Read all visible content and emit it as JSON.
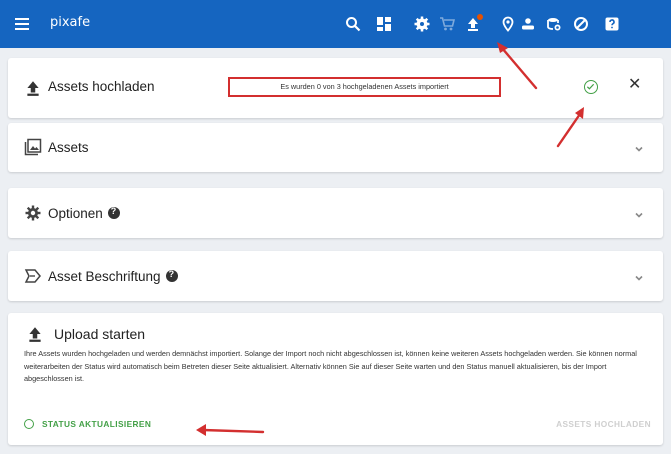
{
  "app": {
    "title": "pixafe"
  },
  "topbar": {
    "icons": [
      "search-icon",
      "dashboard-icon",
      "settings-icon",
      "cart-icon",
      "upload-icon",
      "location-icon",
      "users-icon",
      "stack-icon",
      "help-circle-icon",
      "help-square-icon"
    ]
  },
  "upload_panel": {
    "title": "Assets hochladen",
    "notice": "Es wurden 0 von 3 hochgeladenen Assets importiert"
  },
  "panels": {
    "assets": "Assets",
    "options": "Optionen",
    "labeling": "Asset Beschriftung"
  },
  "start": {
    "title": "Upload starten",
    "description": "Ihre Assets wurden hochgeladen und werden demnächst importiert. Solange der Import noch nicht abgeschlossen ist, können keine weiteren Assets hochgeladen werden. Sie können normal weiterarbeiten der Status wird automatisch beim Betreten dieser Seite aktualisiert. Alternativ können Sie auf dieser Seite warten und den Status manuell aktualisieren, bis der Import abgeschlossen ist.",
    "status_button": "STATUS AKTUALISIEREN",
    "upload_button": "ASSETS HOCHLADEN"
  },
  "colors": {
    "primary": "#1565c0",
    "success": "#43a047",
    "annotation": "#d32f2f"
  }
}
